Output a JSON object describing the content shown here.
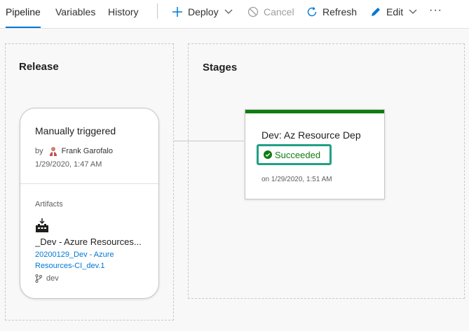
{
  "tabs": [
    {
      "label": "Pipeline",
      "active": true
    },
    {
      "label": "Variables",
      "active": false
    },
    {
      "label": "History",
      "active": false
    }
  ],
  "commands": {
    "deploy": {
      "label": "Deploy",
      "icon": "plus-icon"
    },
    "cancel": {
      "label": "Cancel",
      "icon": "cancel-icon",
      "disabled": true
    },
    "refresh": {
      "label": "Refresh",
      "icon": "refresh-icon"
    },
    "edit": {
      "label": "Edit",
      "icon": "pencil-icon"
    },
    "more": {
      "label": "···",
      "icon": "more-icon"
    }
  },
  "release_section": {
    "title": "Release",
    "card": {
      "trigger": "Manually triggered",
      "by_prefix": "by",
      "author": "Frank Garofalo",
      "date": "1/29/2020, 1:47 AM",
      "artifacts_label": "Artifacts",
      "artifact_name": "_Dev - Azure Resources...",
      "artifact_version": "20200129_Dev - Azure Resources-CI_dev.1",
      "branch": "dev"
    }
  },
  "stages_section": {
    "title": "Stages",
    "stage": {
      "name": "Dev: Az Resource Dep",
      "status": "Succeeded",
      "date": "on 1/29/2020, 1:51 AM"
    }
  },
  "colors": {
    "accent": "#0078d4",
    "success": "#107c10",
    "highlight": "#21a084"
  }
}
